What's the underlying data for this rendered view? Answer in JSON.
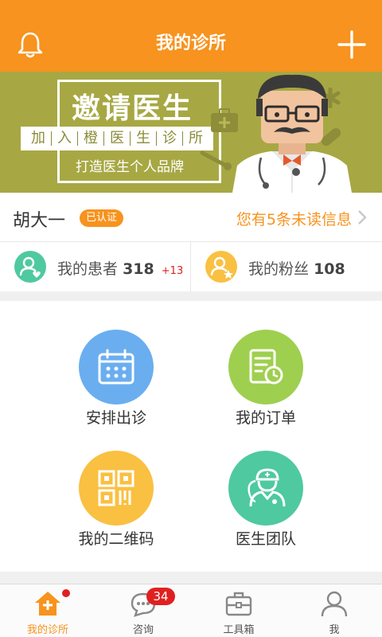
{
  "header": {
    "title": "我的诊所",
    "left_icon": "bell-icon",
    "right_icon": "plus-icon"
  },
  "banner": {
    "headline": "邀请医生",
    "strip": [
      "加",
      "入",
      "橙",
      "医",
      "生",
      "诊",
      "所"
    ],
    "subline": "打造医生个人品牌"
  },
  "user": {
    "name": "胡大一",
    "badge": "已认证",
    "unread": "您有5条未读信息"
  },
  "stats": {
    "patients": {
      "label": "我的患者",
      "count": "318",
      "increase": "+13"
    },
    "fans": {
      "label": "我的粉丝",
      "count": "108"
    }
  },
  "grid": {
    "schedule": {
      "label": "安排出诊",
      "color": "#6aaef0"
    },
    "orders": {
      "label": "我的订单",
      "color": "#9fcf4f"
    },
    "qrcode": {
      "label": "我的二维码",
      "color": "#f9c042"
    },
    "team": {
      "label": "医生团队",
      "color": "#4fc9a0"
    }
  },
  "tabs": {
    "clinic": {
      "label": "我的诊所"
    },
    "consult": {
      "label": "咨询",
      "badge": "34"
    },
    "tools": {
      "label": "工具箱"
    },
    "me": {
      "label": "我"
    }
  },
  "colors": {
    "brand": "#f7931e",
    "banner": "#a7a843",
    "alert": "#e02020"
  }
}
